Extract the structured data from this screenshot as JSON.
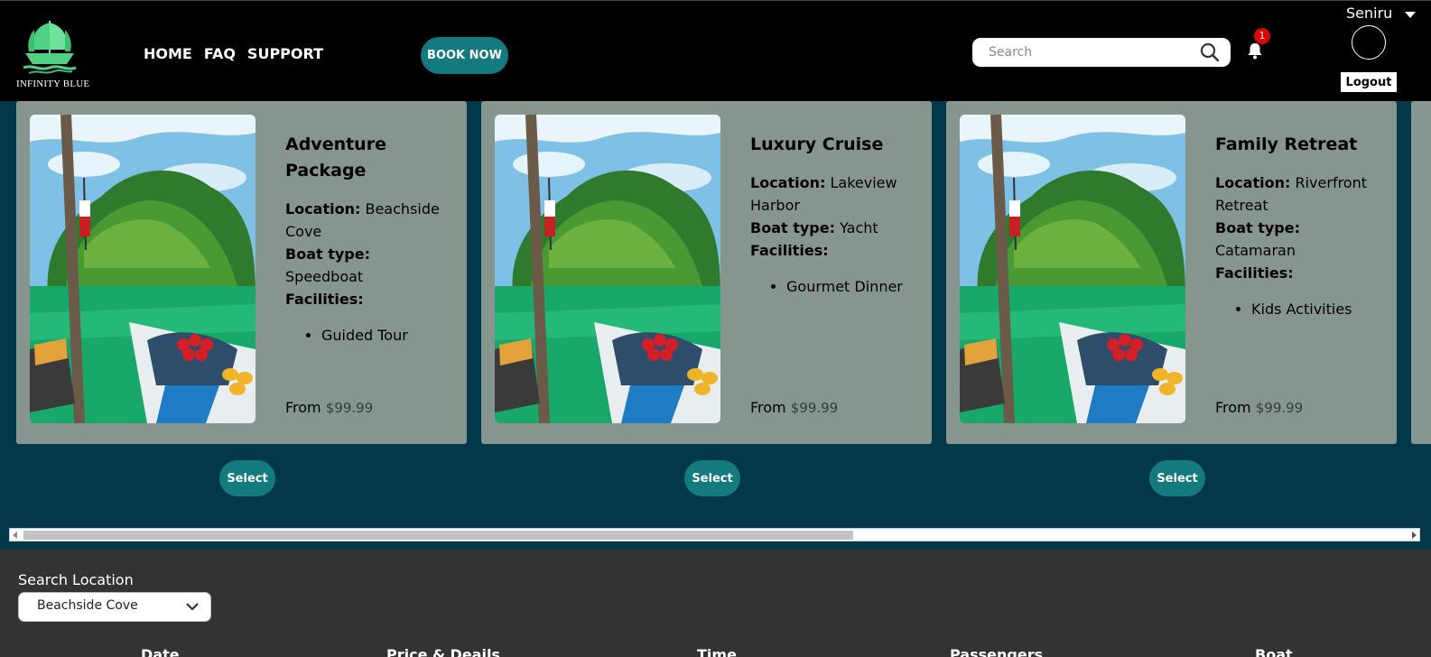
{
  "header": {
    "logo_text": "INFINITY BLUE",
    "nav": [
      "HOME",
      "FAQ",
      "SUPPORT"
    ],
    "book_now": "BOOK NOW",
    "search_placeholder": "Search",
    "notification_count": "1",
    "user_name": "Seniru",
    "logout": "Logout"
  },
  "labels": {
    "location": "Location:",
    "boat_type": "Boat type:",
    "facilities": "Facilities:",
    "from": "From"
  },
  "cards": [
    {
      "title": "Adventure Package",
      "location": "Beachside Cove",
      "boat_type": "Speedboat",
      "facility": "Guided Tour",
      "price": "$99.99",
      "select": "Select"
    },
    {
      "title": "Luxury Cruise",
      "location": "Lakeview Harbor",
      "boat_type": "Yacht",
      "facility": "Gourmet Dinner",
      "price": "$99.99",
      "select": "Select"
    },
    {
      "title": "Family Retreat",
      "location": "Riverfront Retreat",
      "boat_type": "Catamaran",
      "facility": "Kids Activities",
      "price": "$99.99",
      "select": "Select"
    }
  ],
  "scroll_position": 0.6,
  "search_panel": {
    "label": "Search Location",
    "selected_location": "Beachside Cove",
    "columns": [
      "Date",
      "Price & Deails",
      "Time",
      "Passengers",
      "Boat"
    ]
  },
  "colors": {
    "header_bg": "#000000",
    "page_bg": "#02384a",
    "card_bg": "#86968f",
    "accent": "#137a80",
    "panel_bg": "#333333",
    "badge": "#e10000"
  },
  "icons": [
    "ship-logo",
    "search-icon",
    "bell-icon",
    "caret-down-icon",
    "chevron-down-icon"
  ]
}
